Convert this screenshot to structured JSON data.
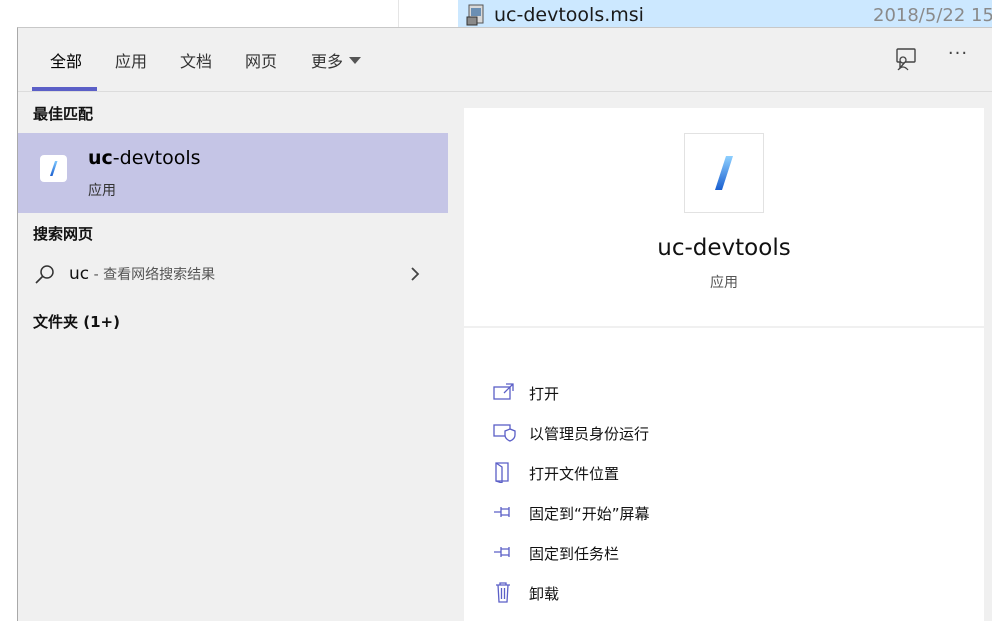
{
  "background_file": {
    "name": "uc-devtools.msi",
    "date": "2018/5/22 15"
  },
  "tabs": [
    {
      "label": "全部",
      "active": true
    },
    {
      "label": "应用",
      "active": false
    },
    {
      "label": "文档",
      "active": false
    },
    {
      "label": "网页",
      "active": false
    },
    {
      "label": "更多",
      "active": false
    }
  ],
  "toolbar": {
    "feedback_icon": "feedback-icon",
    "more_label": "···"
  },
  "left": {
    "best_match_heading": "最佳匹配",
    "best_match": {
      "title_bold": "uc",
      "title_rest": "-devtools",
      "subtitle": "应用"
    },
    "web_heading": "搜索网页",
    "web_result": {
      "query": "uc",
      "description": " - 查看网络搜索结果"
    },
    "folders_heading": "文件夹 (1+)"
  },
  "right": {
    "app_name": "uc-devtools",
    "app_type": "应用",
    "actions": [
      {
        "label": "打开",
        "icon": "open-icon"
      },
      {
        "label": "以管理员身份运行",
        "icon": "run-as-admin-icon"
      },
      {
        "label": "打开文件位置",
        "icon": "file-location-icon"
      },
      {
        "label": "固定到“开始”屏幕",
        "icon": "pin-icon"
      },
      {
        "label": "固定到任务栏",
        "icon": "pin-icon"
      },
      {
        "label": "卸载",
        "icon": "trash-icon"
      }
    ]
  },
  "colors": {
    "accent": "#5b5fc7",
    "selected_bg": "#c5c5e6",
    "panel_bg": "#f0f0f0"
  }
}
